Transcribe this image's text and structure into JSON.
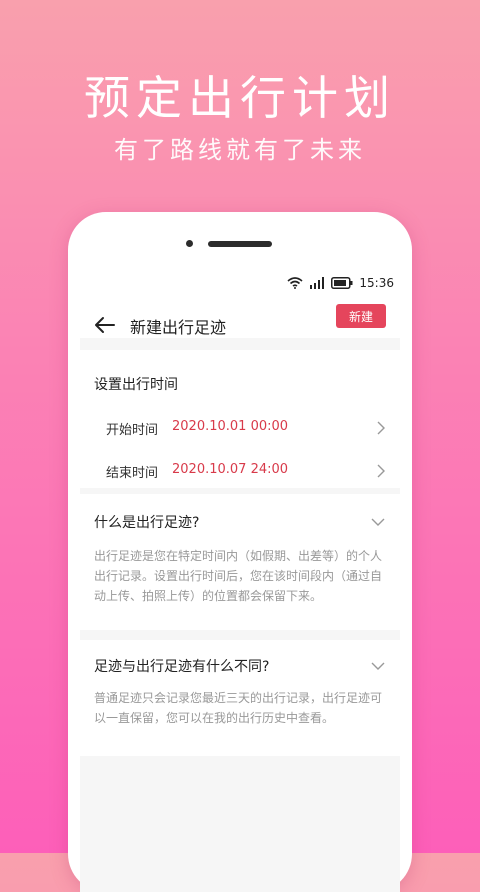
{
  "promo": {
    "headline": "预定出行计划",
    "subline": "有了路线就有了未来"
  },
  "status_bar": {
    "time": "15:36",
    "icons": [
      "wifi-icon",
      "signal-icon",
      "battery-icon"
    ]
  },
  "nav": {
    "title": "新建出行足迹",
    "new_button": "新建"
  },
  "time_section": {
    "title": "设置出行时间",
    "start_label": "开始时间",
    "start_value": "2020.10.01 00:00",
    "end_label": "结束时间",
    "end_value": "2020.10.07 24:00"
  },
  "faq": [
    {
      "question": "什么是出行足迹?",
      "answer": "出行足迹是您在特定时间内（如假期、出差等）的个人出行记录。设置出行时间后，您在该时间段内（通过自动上传、拍照上传）的位置都会保留下来。"
    },
    {
      "question": "足迹与出行足迹有什么不同?",
      "answer": "普通足迹只会记录您最近三天的出行记录，出行足迹可以一直保留，您可以在我的出行历史中查看。"
    }
  ],
  "colors": {
    "accent": "#e5455c",
    "value_text": "#d83a4a"
  }
}
